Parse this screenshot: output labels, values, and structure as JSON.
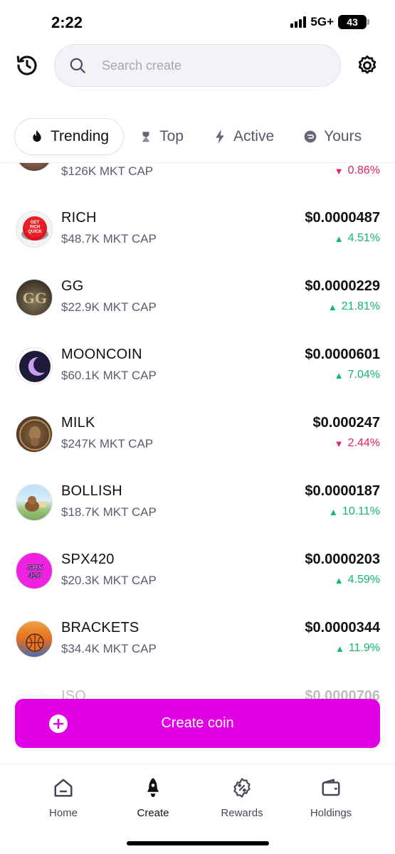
{
  "status_bar": {
    "time": "2:22",
    "network": "5G+",
    "battery": "43"
  },
  "search": {
    "placeholder": "Search create"
  },
  "tabs": [
    {
      "label": "Trending",
      "icon": "flame-icon",
      "active": true
    },
    {
      "label": "Top",
      "icon": "trophy-icon",
      "active": false
    },
    {
      "label": "Active",
      "icon": "lightning-icon",
      "active": false
    },
    {
      "label": "Yours",
      "icon": "coins-icon",
      "active": false
    }
  ],
  "coins": [
    {
      "name": "",
      "cap": "$126K MKT CAP",
      "price": "",
      "change": "0.86%",
      "direction": "down"
    },
    {
      "name": "RICH",
      "cap": "$48.7K MKT CAP",
      "price": "$0.0000487",
      "change": "4.51%",
      "direction": "up"
    },
    {
      "name": "GG",
      "cap": "$22.9K MKT CAP",
      "price": "$0.0000229",
      "change": "21.81%",
      "direction": "up"
    },
    {
      "name": "MOONCOIN",
      "cap": "$60.1K MKT CAP",
      "price": "$0.0000601",
      "change": "7.04%",
      "direction": "up"
    },
    {
      "name": "MILK",
      "cap": "$247K MKT CAP",
      "price": "$0.000247",
      "change": "2.44%",
      "direction": "down"
    },
    {
      "name": "BOLLISH",
      "cap": "$18.7K MKT CAP",
      "price": "$0.0000187",
      "change": "10.11%",
      "direction": "up"
    },
    {
      "name": "SPX420",
      "cap": "$20.3K MKT CAP",
      "price": "$0.0000203",
      "change": "4.59%",
      "direction": "up"
    },
    {
      "name": "BRACKETS",
      "cap": "$34.4K MKT CAP",
      "price": "$0.0000344",
      "change": "11.9%",
      "direction": "up"
    },
    {
      "name": "ISO",
      "cap": "",
      "price": "$0.0000706",
      "change": "",
      "direction": ""
    }
  ],
  "create_button": {
    "label": "Create coin"
  },
  "nav": [
    {
      "label": "Home",
      "icon": "home-icon",
      "active": false
    },
    {
      "label": "Create",
      "icon": "rocket-icon",
      "active": true
    },
    {
      "label": "Rewards",
      "icon": "rewards-badge-icon",
      "active": false
    },
    {
      "label": "Holdings",
      "icon": "wallet-icon",
      "active": false
    }
  ],
  "colors": {
    "accent": "#e100e6",
    "up": "#12b76a",
    "down": "#e0245e"
  }
}
